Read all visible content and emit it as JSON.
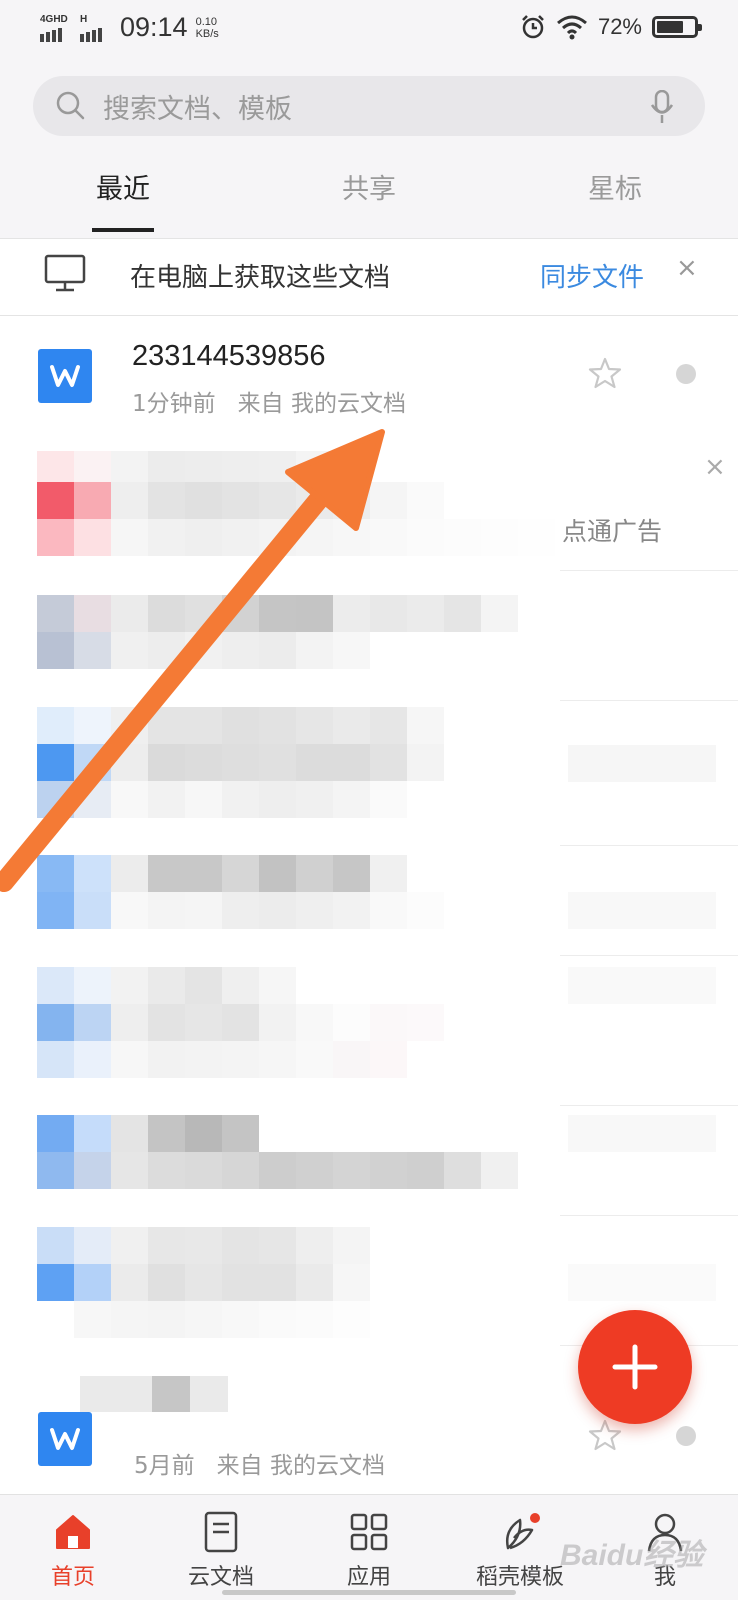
{
  "status_bar": {
    "network1": "4GHD",
    "network2": "H",
    "time": "09:14",
    "speed_value": "0.10",
    "speed_unit": "KB/s",
    "battery": "72%",
    "battery_level": 0.72
  },
  "search": {
    "placeholder": "搜索文档、模板",
    "icon": "search-icon",
    "mic_icon": "microphone-icon"
  },
  "tabs": [
    {
      "label": "最近",
      "active": true
    },
    {
      "label": "共享",
      "active": false
    },
    {
      "label": "星标",
      "active": false
    }
  ],
  "sync_banner": {
    "icon": "monitor-icon",
    "text": "在电脑上获取这些文档",
    "action": "同步文件",
    "close": "×"
  },
  "documents": [
    {
      "title": "233144539856",
      "time": "1分钟前",
      "source": "来自 我的云文档",
      "icon": "word-doc-icon"
    },
    {
      "title": "",
      "time": "5月前",
      "source": "来自 我的云文档",
      "icon": "word-doc-icon"
    }
  ],
  "ad": {
    "label": "点通广告",
    "close": "×"
  },
  "fab": {
    "icon": "plus-icon"
  },
  "bottom_nav": [
    {
      "label": "首页",
      "icon": "home-icon",
      "active": true
    },
    {
      "label": "云文档",
      "icon": "document-icon",
      "active": false
    },
    {
      "label": "应用",
      "icon": "apps-grid-icon",
      "active": false
    },
    {
      "label": "稻壳模板",
      "icon": "leaf-icon",
      "active": false,
      "badge": true
    },
    {
      "label": "我",
      "icon": "person-icon",
      "active": false
    }
  ],
  "watermark": "Baidu经验",
  "colors": {
    "accent": "#ee3b24",
    "link": "#3b8ae0",
    "word_blue": "#2f86f0",
    "arrow": "#f47a35"
  }
}
